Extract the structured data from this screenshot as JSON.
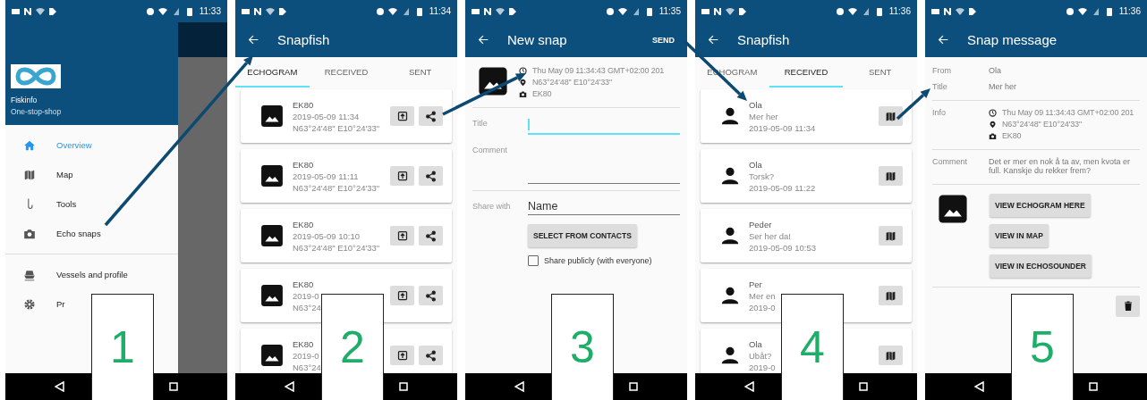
{
  "panels": [
    {
      "kind": "drawer",
      "status_time": "11:33",
      "step": "1",
      "drawer": {
        "app_name": "Fiskinfo",
        "tagline": "One-stop-shop",
        "sections": [
          {
            "items": [
              {
                "label": "Overview",
                "selected": true
              },
              {
                "label": "Map",
                "selected": false
              },
              {
                "label": "Tools",
                "selected": false
              },
              {
                "label": "Echo snaps",
                "selected": false
              }
            ]
          },
          {
            "items": [
              {
                "label": "Vessels and profile",
                "selected": false
              },
              {
                "label": "Pr",
                "selected": false
              }
            ]
          }
        ]
      }
    },
    {
      "kind": "echogram_list",
      "status_time": "11:34",
      "step": "2",
      "title": "Snapfish",
      "tabs": [
        {
          "label": "ECHOGRAM",
          "selected": true
        },
        {
          "label": "RECEIVED",
          "selected": false
        },
        {
          "label": "SENT",
          "selected": false
        }
      ],
      "cards": [
        {
          "source": "EK80",
          "time": "2019-05-09 11:34",
          "position": "N63°24'48\" E10°24'33\""
        },
        {
          "source": "EK80",
          "time": "2019-05-09 11:11",
          "position": "N63°24'48\" E10°24'33\""
        },
        {
          "source": "EK80",
          "time": "2019-05-09 10:10",
          "position": "N63°24'48\" E10°24'33\""
        },
        {
          "source": "EK80",
          "time": "2019-0",
          "position": "N63°24"
        },
        {
          "source": "EK80",
          "time": "2019-0",
          "position": "N63°24"
        }
      ]
    },
    {
      "kind": "new_snap",
      "status_time": "11:35",
      "step": "3",
      "title": "New snap",
      "action": "SEND",
      "info": {
        "time": "Thu May 09 11:34:43 GMT+02:00 201",
        "position": "N63°24'48\" E10°24'33\"",
        "device": "EK80"
      },
      "form": {
        "title_label": "Title",
        "title_focused": true,
        "comment_label": "Comment",
        "share_label": "Share with",
        "share_placeholder": "Name",
        "contacts_button": "SELECT FROM CONTACTS",
        "public_checkbox": {
          "label": "Share publicly (with everyone)",
          "checked": false
        }
      }
    },
    {
      "kind": "received_list",
      "status_time": "11:36",
      "step": "4",
      "title": "Snapfish",
      "tabs": [
        {
          "label": "ECHOGRAM",
          "selected": false
        },
        {
          "label": "RECEIVED",
          "selected": true
        },
        {
          "label": "SENT",
          "selected": false
        }
      ],
      "cards": [
        {
          "sender": "Ola",
          "title": "Mer her",
          "time": "2019-05-09 11:34"
        },
        {
          "sender": "Ola",
          "title": "Torsk?",
          "time": "2019-05-09 11:22"
        },
        {
          "sender": "Peder",
          "title": "Ser her da!",
          "time": "2019-05-09 10:53"
        },
        {
          "sender": "Per",
          "title": "Mer en",
          "time": "2019-0"
        },
        {
          "sender": "Ola",
          "title": "Ubåt?",
          "time": "2019-0"
        }
      ]
    },
    {
      "kind": "snap_message",
      "status_time": "11:36",
      "step": "5",
      "title": "Snap message",
      "from_label": "From",
      "from": "Ola",
      "title_label": "Title",
      "title_value": "Mer her",
      "info_label": "Info",
      "info": {
        "time": "Thu May 09 11:34:43 GMT+02:00 201",
        "position": "N63°24'48\" E10°24'33\"",
        "device": "EK80"
      },
      "comment_label": "Comment",
      "comment": "Det er mer en nok å ta av, men kvota er full. Kanskje du rekker frem?",
      "buttons": [
        "VIEW ECHOGRAM HERE",
        "VIEW IN MAP",
        "VIEW IN ECHOSOUNDER"
      ]
    }
  ]
}
